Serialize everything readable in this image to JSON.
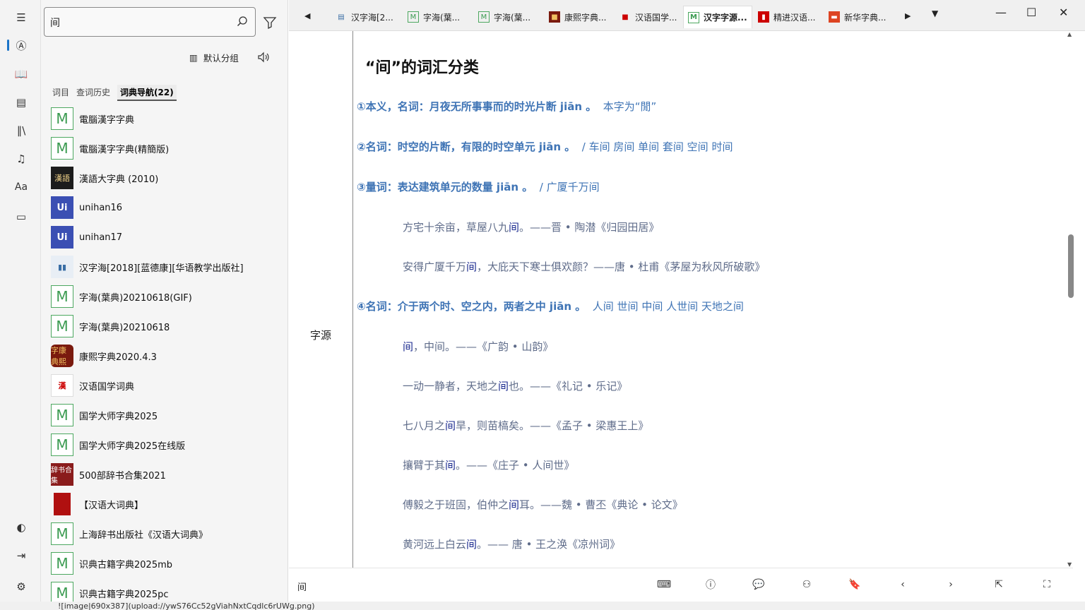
{
  "search": {
    "query": "间"
  },
  "side": {
    "group_label": "默认分组",
    "tabs": [
      "词目",
      "查词历史",
      "词典导航(22)"
    ],
    "dicts": [
      {
        "name": "電腦漢字字典",
        "icon": "M"
      },
      {
        "name": "電腦漢字字典(精簡版)",
        "icon": "M"
      },
      {
        "name": "漢語大字典 (2010)",
        "icon": "漢語"
      },
      {
        "name": "unihan16",
        "icon": "Ui"
      },
      {
        "name": "unihan17",
        "icon": "Ui"
      },
      {
        "name": "汉字海[2018][蓝德康][华语教学出版社]",
        "icon": "book"
      },
      {
        "name": "字海(葉典)20210618(GIF)",
        "icon": "M"
      },
      {
        "name": "字海(葉典)20210618",
        "icon": "M"
      },
      {
        "name": "康熙字典2020.4.3",
        "icon": "字康典熙"
      },
      {
        "name": "汉语国学词典",
        "icon": "漢"
      },
      {
        "name": "国学大师字典2025",
        "icon": "M"
      },
      {
        "name": "国学大师字典2025在线版",
        "icon": "M"
      },
      {
        "name": "500部辞书合集2021",
        "icon": "辞书合集"
      },
      {
        "name": "【汉语大词典】",
        "icon": "red"
      },
      {
        "name": "上海辞书出版社《汉语大词典》",
        "icon": "M"
      },
      {
        "name": "识典古籍字典2025mb",
        "icon": "M"
      },
      {
        "name": "识典古籍字典2025pc",
        "icon": "M"
      }
    ]
  },
  "tabs": [
    {
      "label": "汉字海[2..."
    },
    {
      "label": "字海(葉..."
    },
    {
      "label": "字海(葉..."
    },
    {
      "label": "康熙字典..."
    },
    {
      "label": "汉语国学..."
    },
    {
      "label": "汉字字源..."
    },
    {
      "label": "精进汉语..."
    },
    {
      "label": "新华字典..."
    }
  ],
  "entry": {
    "side_label": "字源",
    "title": "“间”的词汇分类",
    "defs": [
      {
        "head": "①本义，名词：月夜无所事事而的时光片断 jiān 。",
        "tail": "本字为“閒”"
      },
      {
        "head": "②名词：时空的片断，有限的时空单元 jiān 。",
        "tail": "/ 车间 房间 单间 套间 空间 时间"
      },
      {
        "head": "③量词：表达建筑单元的数量 jiān 。",
        "tail": "/ 广厦千万间"
      },
      {
        "head": "④名词：介于两个时、空之内，两者之中 jiān 。",
        "tail": "人间 世间 中间 人世间 天地之间"
      }
    ],
    "examples": [
      {
        "pre": "方宅十余亩，草屋八九",
        "key": "间",
        "post": "。——晋 • 陶潜《归园田居》"
      },
      {
        "pre": "安得广厦千万",
        "key": "间",
        "post": "，大庇天下寒士俱欢颜？——唐 • 杜甫《茅屋为秋风所破歌》"
      },
      {
        "pre": "",
        "key": "间",
        "post": "，中间。——《广韵 • 山韵》"
      },
      {
        "pre": "一动一静者，天地之",
        "key": "间",
        "post": "也。——《礼记 • 乐记》"
      },
      {
        "pre": "七八月之",
        "key": "间",
        "post": "旱，则苗槁矣。——《孟子 • 梁惠王上》"
      },
      {
        "pre": "攘臂于其",
        "key": "间",
        "post": "。——《庄子 • 人间世》"
      },
      {
        "pre": "傅毅之于班固，伯仲之",
        "key": "间",
        "post": "耳。——魏 • 曹丕《典论 • 论文》"
      },
      {
        "pre": "黄河远上白云",
        "key": "间",
        "post": "。—— 唐 • 王之涣《凉州词》"
      }
    ]
  },
  "bottom": {
    "word": "间"
  },
  "behind_text": "![image|690x387](upload://ywS76Cc52gViahNxtCqdlc6rUWg.png)"
}
